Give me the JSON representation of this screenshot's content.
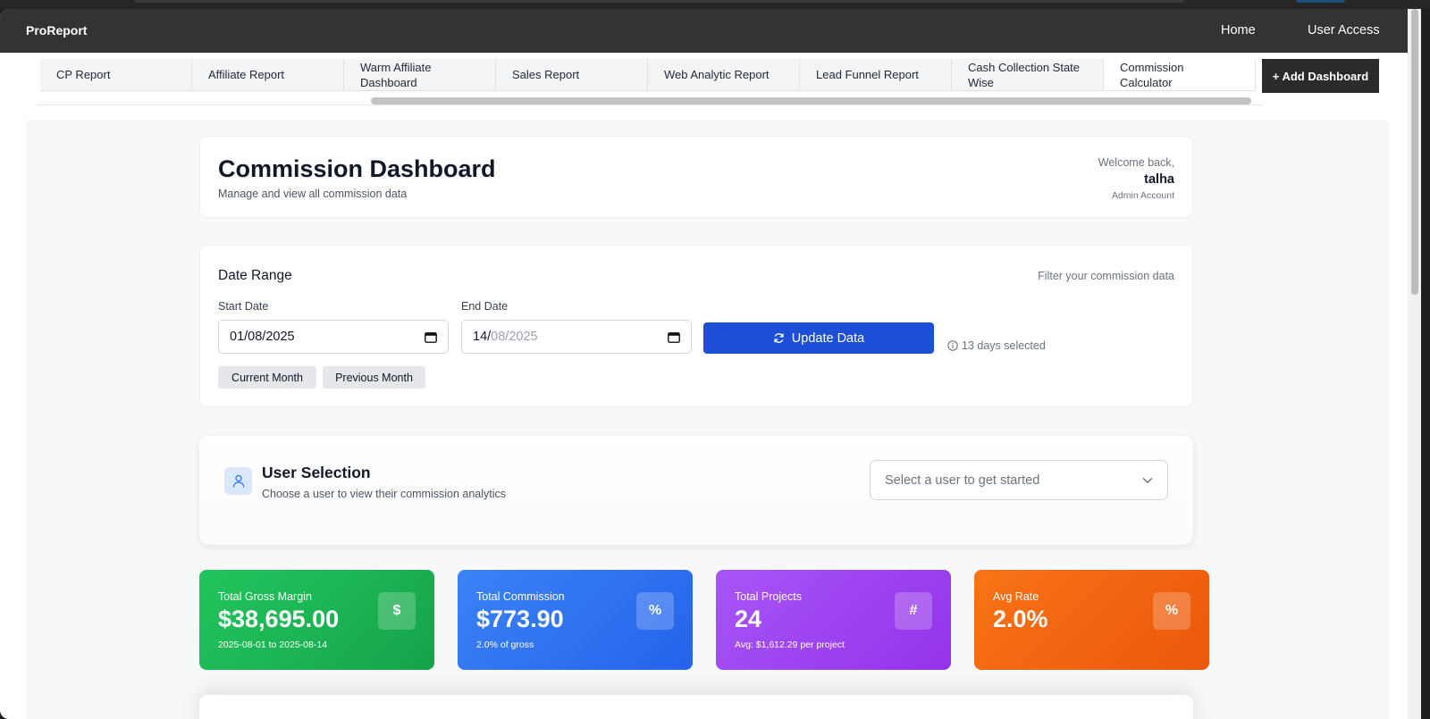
{
  "app": {
    "brand": "ProReport",
    "nav": [
      "Home",
      "User Access"
    ]
  },
  "tabs": [
    "CP Report",
    "Affiliate Report",
    "Warm Affiliate Dashboard",
    "Sales Report",
    "Web Analytic Report",
    "Lead Funnel Report",
    "Cash Collection State Wise",
    "Commission Calculator"
  ],
  "add_dashboard_label": "+ Add Dashboard",
  "header": {
    "title": "Commission Dashboard",
    "subtitle": "Manage and view all commission data",
    "welcome": "Welcome back,",
    "username": "talha",
    "account": "Admin Account"
  },
  "date_range": {
    "title": "Date Range",
    "note": "Filter your commission data",
    "start_label": "Start Date",
    "start_value": "01/08/2025",
    "end_label": "End Date",
    "end_day": "14/",
    "end_month": "08/",
    "end_year": "2025",
    "update_label": "Update Data",
    "days_selected": "13 days selected",
    "current_month": "Current Month",
    "previous_month": "Previous Month"
  },
  "user_selection": {
    "title": "User Selection",
    "subtitle": "Choose a user to view their commission analytics",
    "placeholder": "Select a user to get started"
  },
  "stats": [
    {
      "label": "Total Gross Margin",
      "value": "$38,695.00",
      "foot": "2025-08-01 to 2025-08-14",
      "icon": "$",
      "color": "#16a34a"
    },
    {
      "label": "Total Commission",
      "value": "$773.90",
      "foot": "2.0% of gross",
      "icon": "%",
      "color": "#2563eb"
    },
    {
      "label": "Total Projects",
      "value": "24",
      "foot": "Avg: $1,612.29 per project",
      "icon": "#",
      "color": "#9333ea"
    },
    {
      "label": "Avg Rate",
      "value": "2.0%",
      "foot": "",
      "icon": "%",
      "color": "#ea580c"
    }
  ]
}
